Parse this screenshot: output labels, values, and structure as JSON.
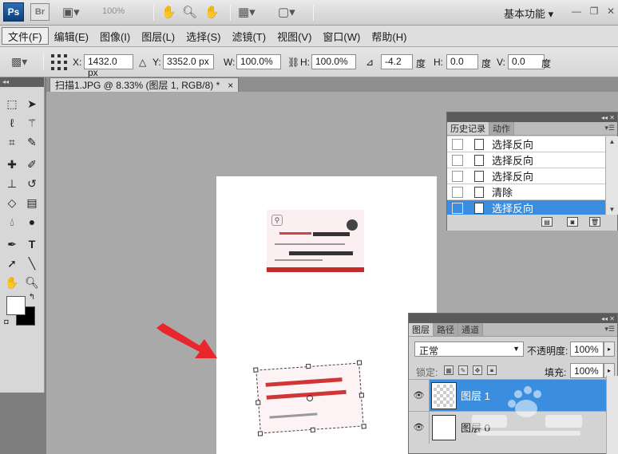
{
  "appbar": {
    "logo": "Ps",
    "bridge": "Br",
    "zoom": "100%",
    "workspace": "基本功能",
    "window_controls": [
      "minimize-icon",
      "restore-icon",
      "close-icon"
    ]
  },
  "menu": [
    "文件(F)",
    "编辑(E)",
    "图像(I)",
    "图层(L)",
    "选择(S)",
    "滤镜(T)",
    "视图(V)",
    "窗口(W)",
    "帮助(H)"
  ],
  "options": {
    "x_label": "X:",
    "x_value": "1432.0 px",
    "y_label": "Y:",
    "y_value": "3352.0 px",
    "w_label": "W:",
    "w_value": "100.0%",
    "h_label": "H:",
    "h_value": "100.0%",
    "angle_value": "-4.2",
    "angle_unit": "度",
    "hskew_label": "H:",
    "hskew_value": "0.0",
    "hskew_unit": "度",
    "vskew_label": "V:",
    "vskew_value": "0.0",
    "vskew_unit": "度"
  },
  "document_tab": {
    "title": "扫描1.JPG @ 8.33% (图层 1, RGB/8) *",
    "close": "×"
  },
  "history_panel": {
    "tabs": [
      "历史记录",
      "动作"
    ],
    "items": [
      {
        "label": "选择反向",
        "selected": false
      },
      {
        "label": "选择反向",
        "selected": false
      },
      {
        "label": "选择反向",
        "selected": false
      },
      {
        "label": "清除",
        "selected": false
      },
      {
        "label": "选择反向",
        "selected": true
      }
    ]
  },
  "layers_panel": {
    "tabs": [
      "图层",
      "路径",
      "通道"
    ],
    "blend_mode": "正常",
    "opacity_label": "不透明度:",
    "opacity_value": "100%",
    "lock_label": "锁定:",
    "fill_label": "填充:",
    "fill_value": "100%",
    "layers": [
      {
        "name": "图层 1",
        "selected": true
      },
      {
        "name": "图层 0",
        "selected": false
      }
    ]
  },
  "colors": {
    "accent": "#3b8de0",
    "arrow": "#e8262c"
  }
}
